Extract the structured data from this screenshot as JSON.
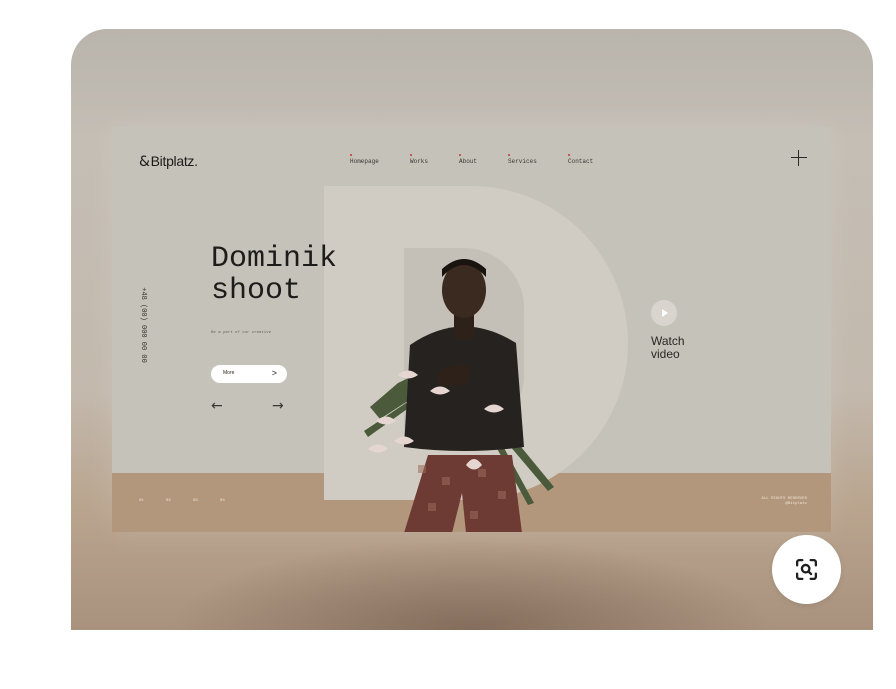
{
  "preview": {
    "site": {
      "logo_glyph": "&",
      "logo_text": "Bitplatz.",
      "nav": [
        "Homepage",
        "Works",
        "About",
        "Services",
        "Contact"
      ],
      "title_line1": "Dominik",
      "title_line2": "shoot",
      "subtitle": "Be a part of our creative",
      "more_label": "More",
      "more_chevron": ">",
      "prev_arrow": "←",
      "next_arrow": "→",
      "phone": "+48 (00) 000 00 00",
      "watch_line1": "Watch",
      "watch_line2": "video",
      "pager": [
        "01",
        "02",
        "03",
        "04"
      ],
      "rights_line1": "ALL RIGHTS RESERVED",
      "rights_line2": "@Bitplatz"
    }
  },
  "actions": {
    "visual_search_icon": "lens-search-icon"
  },
  "colors": {
    "accent_dot": "#c23a2b",
    "background": "#c5c2ba",
    "floor": "#b3977c"
  }
}
